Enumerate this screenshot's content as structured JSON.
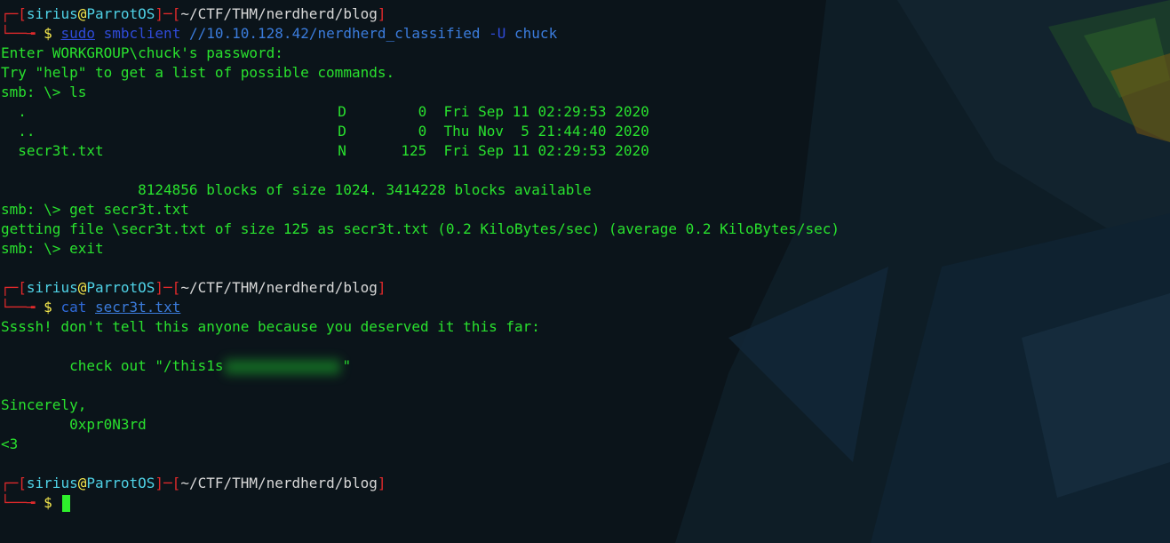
{
  "prompt": {
    "user": "sirius",
    "at": "@",
    "host": "ParrotOS",
    "path": "~/CTF/THM/nerdherd/blog",
    "dollar": "$"
  },
  "session": {
    "cmd1": {
      "sudo": "sudo",
      "prog": "smbclient",
      "target": "//10.10.128.42/nerdherd_classified",
      "flag": "-U",
      "user": "chuck"
    },
    "out_password": "Enter WORKGROUP\\chuck's password:",
    "out_help": "Try \"help\" to get a list of possible commands.",
    "smb_prompt": "smb: \\>",
    "ls_cmd": "ls",
    "listing": [
      {
        "name": ".",
        "type": "D",
        "size": "0",
        "date": "Fri Sep 11 02:29:53 2020"
      },
      {
        "name": "..",
        "type": "D",
        "size": "0",
        "date": "Thu Nov  5 21:44:40 2020"
      },
      {
        "name": "secr3t.txt",
        "type": "N",
        "size": "125",
        "date": "Fri Sep 11 02:29:53 2020"
      }
    ],
    "blocks": "8124856 blocks of size 1024. 3414228 blocks available",
    "get_cmd": "get secr3t.txt",
    "getting": "getting file \\secr3t.txt of size 125 as secr3t.txt (0.2 KiloBytes/sec) (average 0.2 KiloBytes/sec)",
    "exit_cmd": "exit",
    "cat_prog": "cat",
    "cat_file": "secr3t.txt",
    "secret_line1": "Ssssh! don't tell this anyone because you deserved it this far:",
    "secret_check_prefix": "        check out \"/this1s",
    "secret_check_suffix": "\"",
    "sincerely": "Sincerely,",
    "signer": "        0xpr0N3rd",
    "heart": "<3"
  }
}
